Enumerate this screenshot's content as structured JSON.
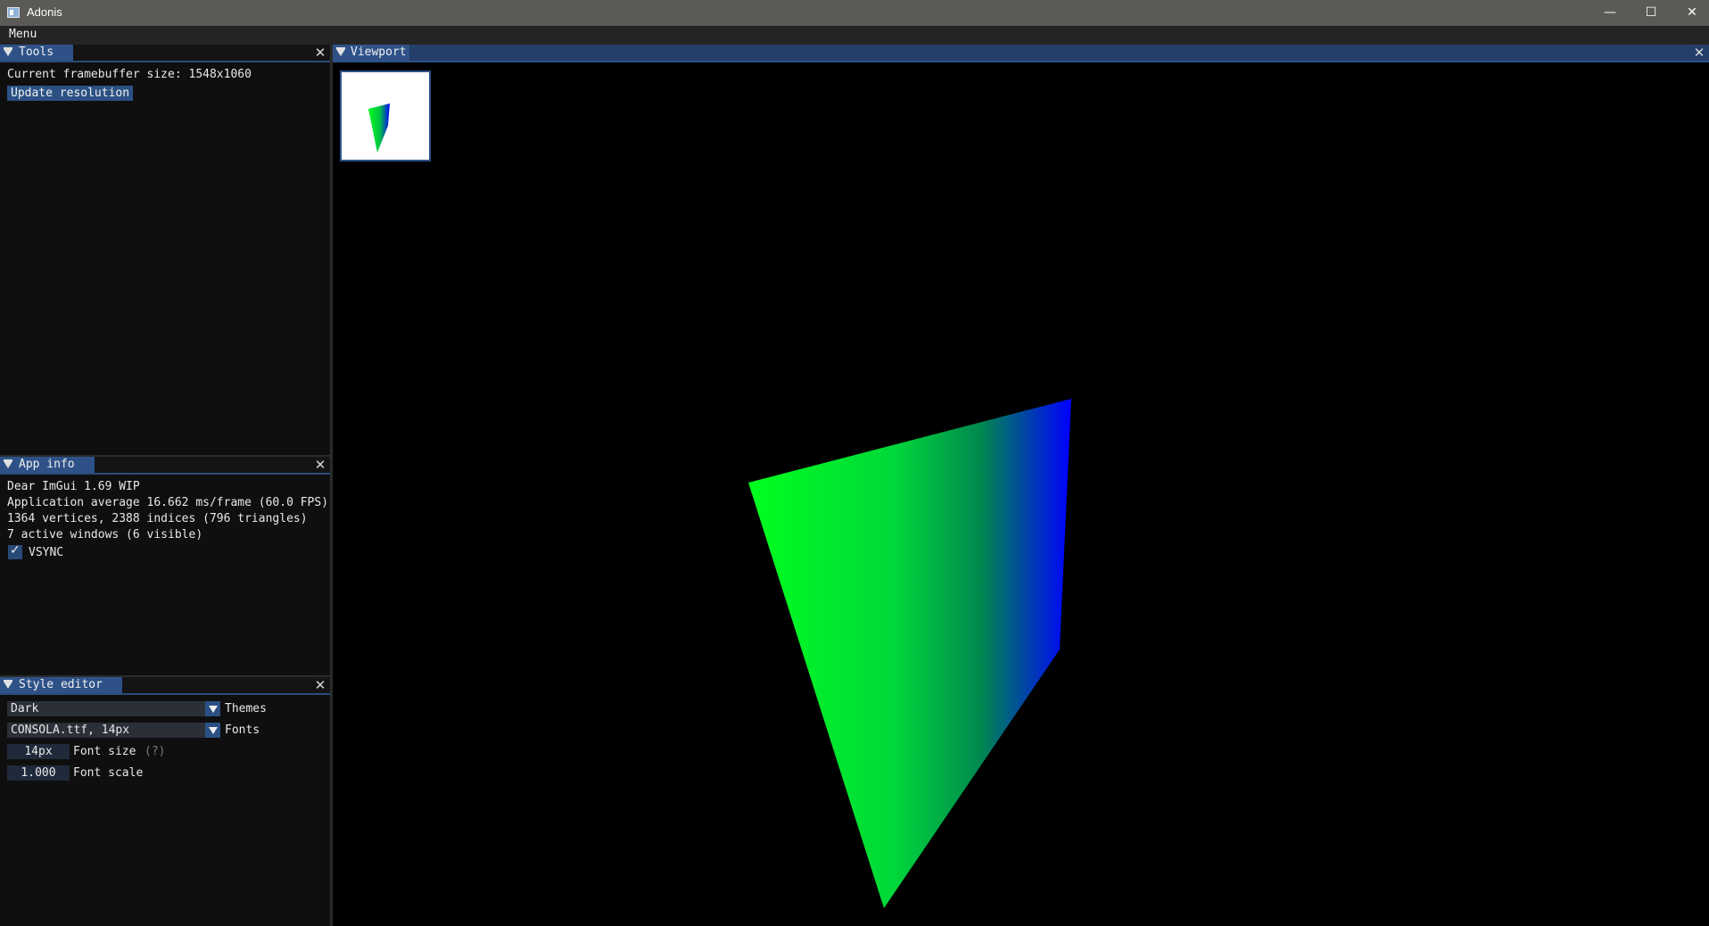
{
  "window": {
    "title": "Adonis",
    "minimize_glyph": "—",
    "maximize_glyph": "☐",
    "close_glyph": "✕"
  },
  "menubar": {
    "menu_label": "Menu"
  },
  "tools": {
    "tab_label": "Tools",
    "framebuffer_text": "Current framebuffer size: 1548x1060",
    "update_button": "Update resolution"
  },
  "app_info": {
    "tab_label": "App info",
    "lines": [
      "Dear ImGui 1.69 WIP",
      "Application average 16.662 ms/frame (60.0 FPS)",
      "1364 vertices, 2388 indices (796 triangles)",
      "7 active windows (6 visible)"
    ],
    "vsync_label": "VSYNC",
    "vsync_checked": true
  },
  "style_editor": {
    "tab_label": "Style editor",
    "theme_value": "Dark",
    "theme_label": "Themes",
    "font_value": "CONSOLA.ttf, 14px",
    "font_label": "Fonts",
    "font_size_value": "14px",
    "font_size_label": "Font size",
    "font_size_help": "(?)",
    "font_scale_value": "1.000",
    "font_scale_label": "Font scale"
  },
  "viewport": {
    "tab_label": "Viewport",
    "gradient_colors": [
      "#00ff1e",
      "#00c045",
      "#0000ff"
    ],
    "thumbnail_background": "#ffffff"
  },
  "close_glyph": "✕",
  "check_glyph": "✓",
  "colors": {
    "accent": "#2e5288",
    "panel_bg": "#0f0f0f",
    "titlebar_bg": "#5c5a57"
  }
}
